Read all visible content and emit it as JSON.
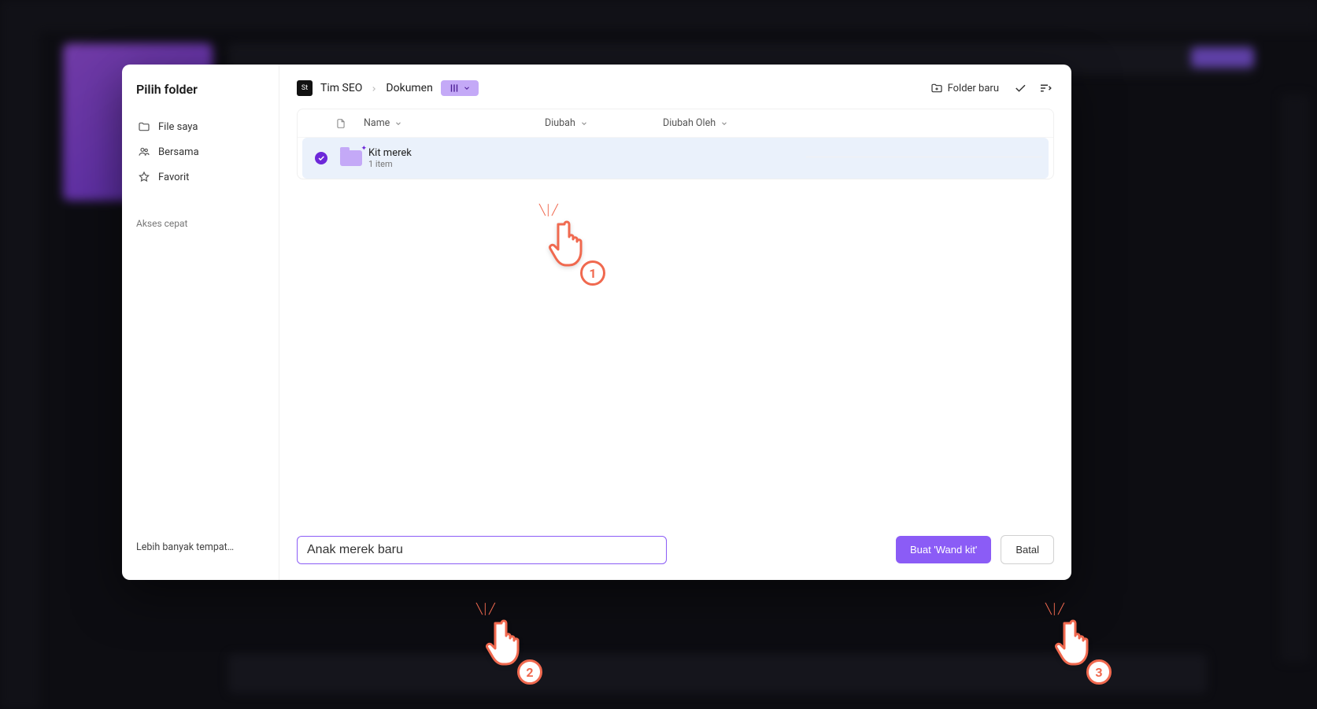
{
  "dialog": {
    "title": "Pilih folder",
    "sidebar_items": [
      {
        "label": "File saya",
        "icon": "folder-icon"
      },
      {
        "label": "Bersama",
        "icon": "people-icon"
      },
      {
        "label": "Favorit",
        "icon": "star-icon"
      }
    ],
    "sidebar_quick_access": "Akses cepat",
    "sidebar_more": "Lebih banyak tempat…"
  },
  "breadcrumb": {
    "team_avatar": "St",
    "team": "Tim SEO",
    "segment": "Dokumen"
  },
  "toolbar": {
    "new_folder": "Folder baru"
  },
  "columns": {
    "name": "Name",
    "modified": "Diubah",
    "modified_by": "Diubah Oleh"
  },
  "files": [
    {
      "name": "Kit merek",
      "subtitle": "1 item",
      "selected": true
    }
  ],
  "footer": {
    "input_value": "Anak merek baru",
    "create_label": "Buat 'Wand kit'",
    "cancel_label": "Batal"
  },
  "annotations": {
    "step1": "1",
    "step2": "2",
    "step3": "3"
  }
}
